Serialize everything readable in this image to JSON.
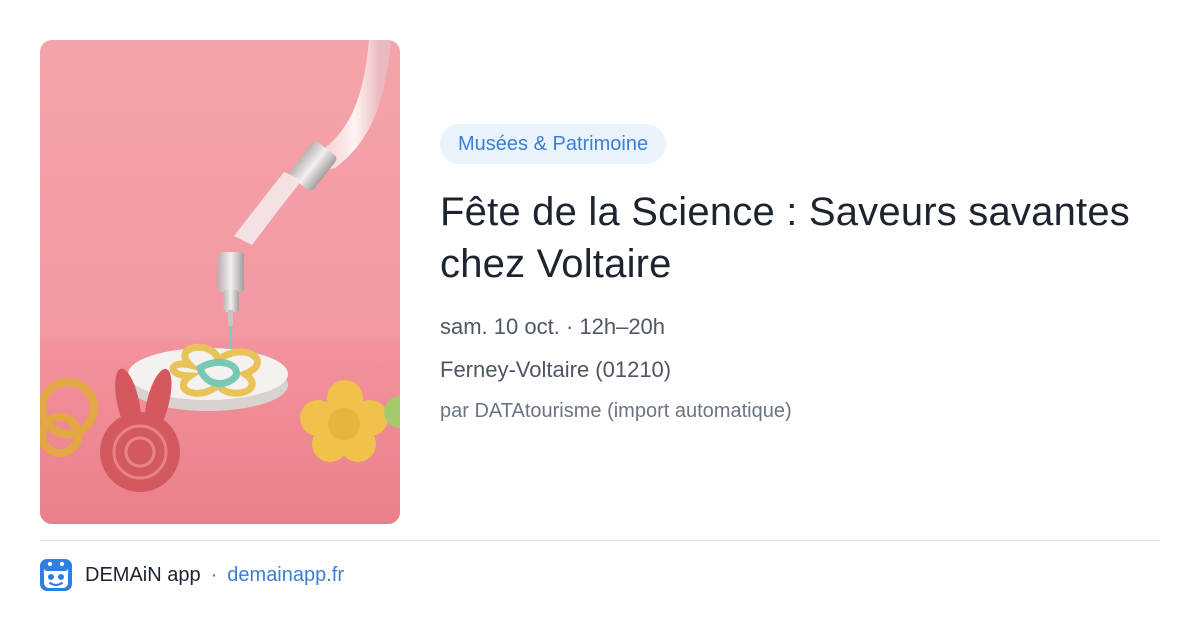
{
  "event": {
    "category": "Musées & Patrimoine",
    "title": "Fête de la Science : Saveurs savantes chez Voltaire",
    "datetime": "sam. 10 oct. · 12h–20h",
    "location": "Ferney-Voltaire (01210)",
    "source": "par DATAtourisme (import automatique)"
  },
  "footer": {
    "app_name": "DEMAiN app",
    "separator": "·",
    "url": "demainapp.fr"
  },
  "colors": {
    "accent": "#3a7fd4",
    "badge_bg": "#eaf3fb",
    "title": "#1c2430",
    "image_bg": "#f29aa3"
  }
}
